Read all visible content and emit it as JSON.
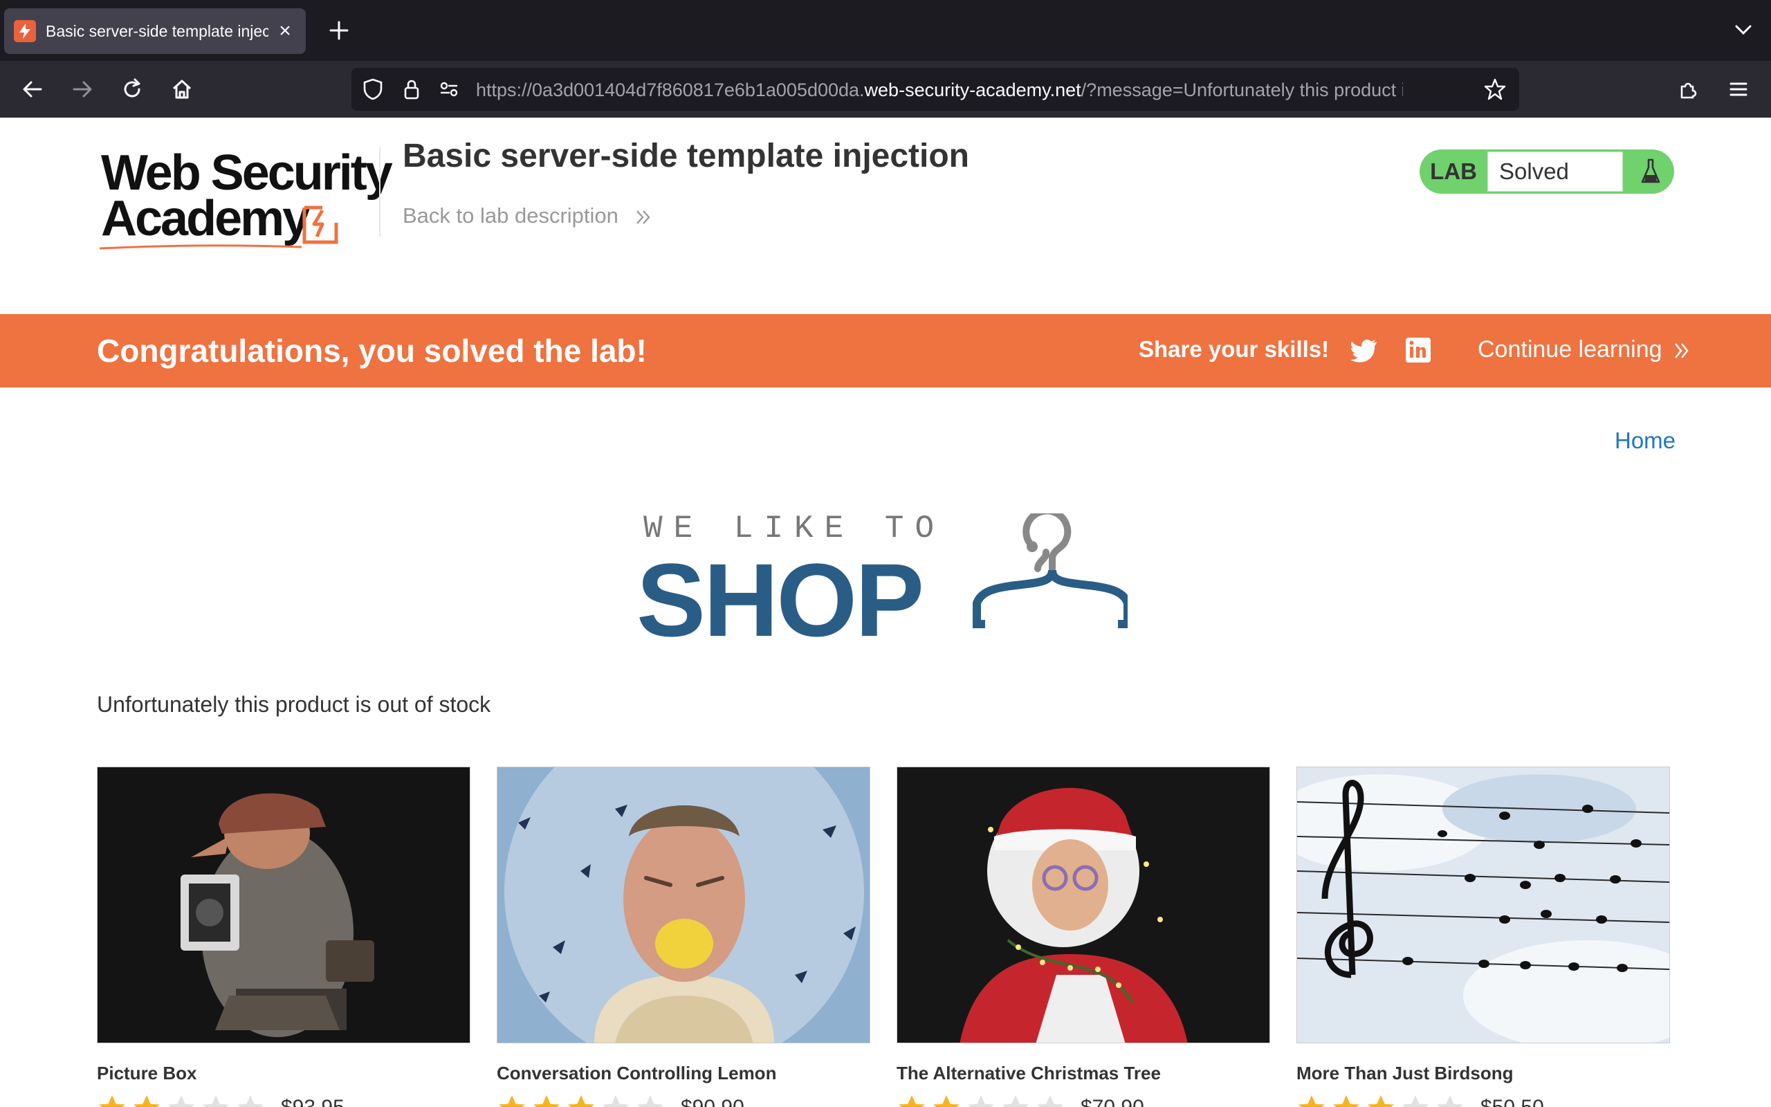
{
  "browser": {
    "tab_title": "Basic server-side template injection",
    "url_prefix": "https://0a3d001404d7f860817e6b1a005d00da.",
    "url_host": "web-security-academy.net",
    "url_path": "/?message=Unfortunately this product is out of stock"
  },
  "header": {
    "logo_line1": "Web Security",
    "logo_line2": "Academy",
    "lab_title": "Basic server-side template injection",
    "back_link": "Back to lab description",
    "status_label": "LAB",
    "status_value": "Solved"
  },
  "banner": {
    "message": "Congratulations, you solved the lab!",
    "share_label": "Share your skills!",
    "continue_label": "Continue learning"
  },
  "shop": {
    "home_link": "Home",
    "tagline": "WE LIKE TO",
    "shop_word": "SHOP",
    "message": "Unfortunately this product is out of stock",
    "products": [
      {
        "name": "Picture Box",
        "rating": 2,
        "price": "$93.95"
      },
      {
        "name": "Conversation Controlling Lemon",
        "rating": 3,
        "price": "$90.90"
      },
      {
        "name": "The Alternative Christmas Tree",
        "rating": 2,
        "price": "$70.90"
      },
      {
        "name": "More Than Just Birdsong",
        "rating": 3,
        "price": "$50.50"
      }
    ]
  },
  "colors": {
    "accent_orange": "#ef7241",
    "solved_green": "#70d16d",
    "shop_blue": "#2a5d86",
    "link_blue": "#2176c1"
  }
}
